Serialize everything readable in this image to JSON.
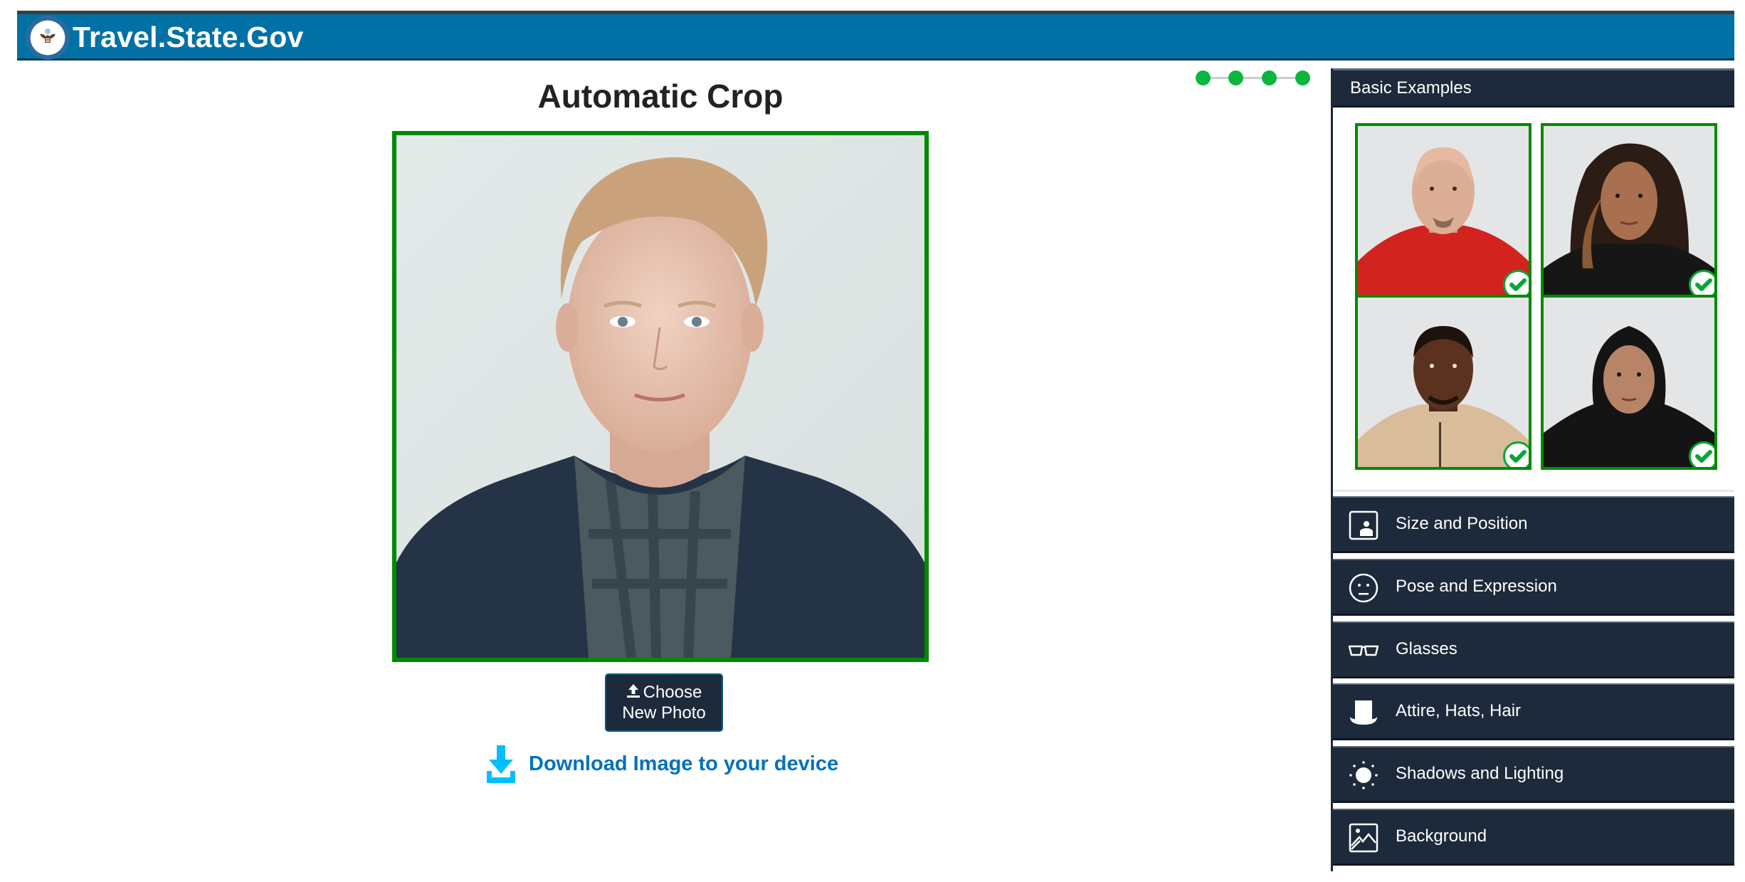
{
  "header": {
    "site_title": "Travel.State.Gov",
    "logo_icon": "department-of-state-seal-icon",
    "brand_color": "#0071a4"
  },
  "main": {
    "title": "Automatic Crop",
    "photo": {
      "description": "Cropped passport photo of a young man with light hair, plaid shirt and dark jacket on a light background",
      "status": "accepted",
      "border_color": "#008a00"
    },
    "choose_button": {
      "icon": "upload-icon",
      "line1": "Choose",
      "line2": "New Photo"
    },
    "download_link": {
      "icon": "download-icon",
      "label": "Download Image to your device",
      "color": "#0071bc"
    }
  },
  "progress": {
    "steps_total": 4,
    "steps_completed": 4,
    "color": "#0bb63f"
  },
  "panel": {
    "header": "Basic Examples",
    "examples": [
      {
        "description": "Bald man in red shirt",
        "status": "acceptable",
        "badge_icon": "check-circle-icon"
      },
      {
        "description": "Woman with long dark hair in black top",
        "status": "acceptable",
        "badge_icon": "check-circle-icon"
      },
      {
        "description": "Man in beige polo shirt",
        "status": "acceptable",
        "badge_icon": "check-circle-icon"
      },
      {
        "description": "Woman wearing black hijab",
        "status": "acceptable",
        "badge_icon": "check-circle-icon"
      }
    ],
    "sections": [
      {
        "label": "Size and Position",
        "icon": "portrait-frame-icon"
      },
      {
        "label": "Pose and Expression",
        "icon": "neutral-face-icon"
      },
      {
        "label": "Glasses",
        "icon": "glasses-icon"
      },
      {
        "label": "Attire, Hats, Hair",
        "icon": "top-hat-icon"
      },
      {
        "label": "Shadows and Lighting",
        "icon": "sun-icon"
      },
      {
        "label": "Background",
        "icon": "image-icon"
      }
    ]
  }
}
